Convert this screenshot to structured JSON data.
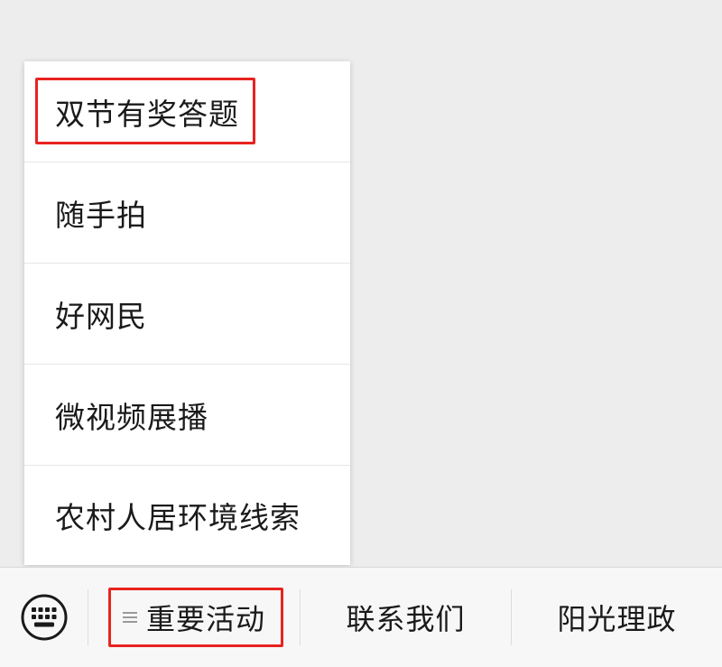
{
  "popup_menu": {
    "items": [
      {
        "label": "双节有奖答题"
      },
      {
        "label": "随手拍"
      },
      {
        "label": "好网民"
      },
      {
        "label": "微视频展播"
      },
      {
        "label": "农村人居环境线索"
      }
    ],
    "highlighted_index": 0
  },
  "bottom_bar": {
    "keyboard_icon": "keyboard-icon",
    "tabs": [
      {
        "label": "重要活动",
        "has_submenu_icon": true,
        "highlighted": true
      },
      {
        "label": "联系我们"
      },
      {
        "label": "阳光理政"
      }
    ]
  },
  "colors": {
    "highlight": "#e8231f",
    "background": "#ededed",
    "menu_background": "#ffffff",
    "bar_background": "#f7f7f7"
  }
}
